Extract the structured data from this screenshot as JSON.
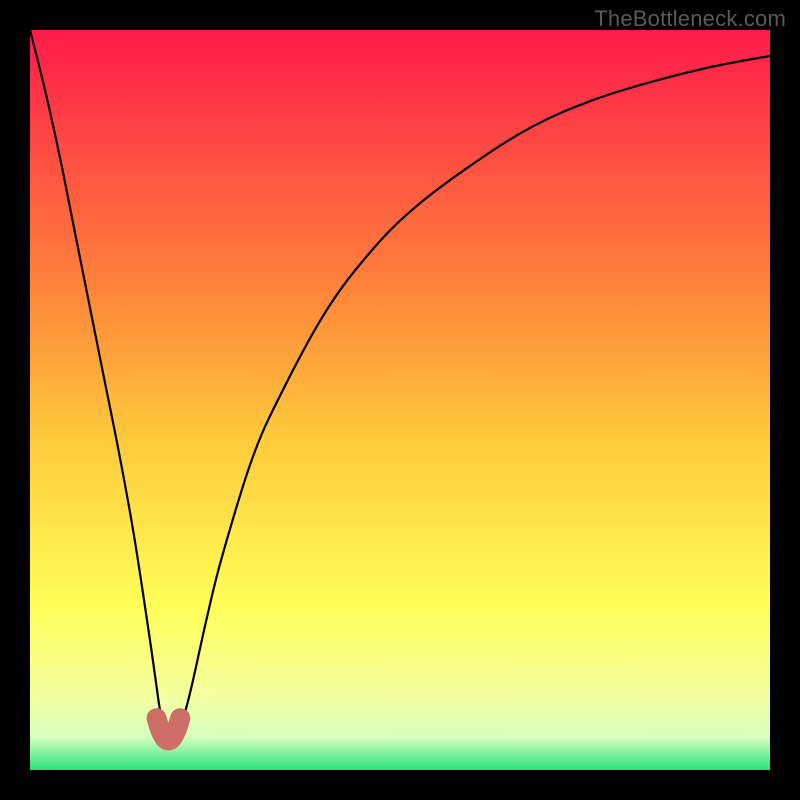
{
  "watermark": "TheBottleneck.com",
  "chart_data": {
    "type": "line",
    "title": "",
    "xlabel": "",
    "ylabel": "",
    "xlim": [
      0,
      100
    ],
    "ylim": [
      0,
      100
    ],
    "grid": false,
    "legend": false,
    "background_gradient": {
      "stops": [
        {
          "offset": 0.0,
          "color": "#ff1a4b"
        },
        {
          "offset": 0.35,
          "color": "#ff843a"
        },
        {
          "offset": 0.55,
          "color": "#ffc93b"
        },
        {
          "offset": 0.78,
          "color": "#ffff57"
        },
        {
          "offset": 0.9,
          "color": "#f3ffa0"
        },
        {
          "offset": 0.955,
          "color": "#d8ffc0"
        },
        {
          "offset": 1.0,
          "color": "#28e37a"
        }
      ]
    },
    "series": [
      {
        "name": "bottleneck-curve",
        "color": "#000000",
        "x": [
          0,
          2,
          4,
          6,
          8,
          10,
          12,
          14,
          16,
          17,
          17.5,
          18,
          18.5,
          19,
          19.5,
          20,
          21,
          22,
          24,
          26,
          30,
          34,
          40,
          46,
          52,
          60,
          68,
          76,
          84,
          92,
          100
        ],
        "y": [
          100,
          92,
          83,
          73,
          63,
          53,
          43,
          32,
          19,
          12,
          8.5,
          6.0,
          4.8,
          4.2,
          4.4,
          5.2,
          8.0,
          12,
          21,
          29,
          42,
          51,
          62,
          70,
          76,
          82,
          87,
          90.5,
          93,
          95,
          96.5
        ]
      }
    ],
    "trough": {
      "x": 18.7,
      "y": 4.0,
      "marker_color": "#cc6d66",
      "marker_radius_px": 10
    }
  }
}
